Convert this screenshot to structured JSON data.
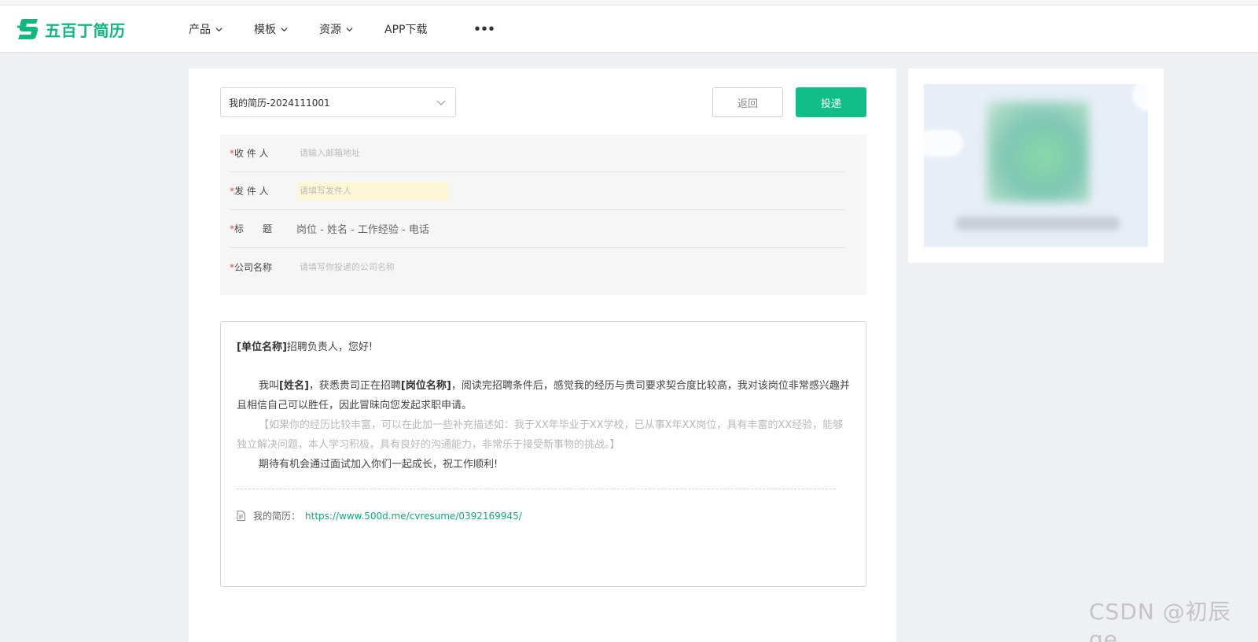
{
  "brand": {
    "name": "五百丁简历",
    "color": "#12b77d"
  },
  "nav": {
    "items": [
      {
        "label": "产品",
        "has_dropdown": true
      },
      {
        "label": "模板",
        "has_dropdown": true
      },
      {
        "label": "资源",
        "has_dropdown": true
      },
      {
        "label": "APP下载",
        "has_dropdown": false
      }
    ],
    "more": "•••"
  },
  "toolbar": {
    "resume_select_value": "我的简历-2024111001",
    "back_label": "返回",
    "send_label": "投递",
    "accent": "#0fbf87"
  },
  "form": {
    "required_mark": "*",
    "recipient_label": "收 件 人",
    "recipient_placeholder": "请输入邮箱地址",
    "sender_label": "发 件 人",
    "sender_placeholder": "请填写发件人",
    "subject_label": "标　　题",
    "subject_value": "岗位 - 姓名 - 工作经验 - 电话",
    "company_label": "公司名称",
    "company_placeholder": "请填写你投递的公司名称"
  },
  "letter": {
    "greeting_bold": "[单位名称]",
    "greeting_rest": "招聘负责人，您好!",
    "p1_a": "我叫",
    "p1_b": "[姓名]",
    "p1_c": "，获悉贵司正在招聘",
    "p1_d": "[岗位名称]",
    "p1_e": "，阅读完招聘条件后，感觉我的经历与贵司要求契合度比较高，我对该岗位非常感兴趣并且相信自己可以胜任，因此冒昧向您发起求职申请。",
    "p2": "【如果你的经历比较丰富，可以在此加一些补充描述如：我于XX年毕业于XX学校，已从事X年XX岗位，具有丰富的XX经验，能够独立解决问题，本人学习积极，具有良好的沟通能力，非常乐于接受新事物的挑战。】",
    "p3": "期待有机会通过面试加入你们一起成长，祝工作顺利!",
    "resume_link_label": "我的简历：",
    "resume_link_url": "https://www.500d.me/cvresume/0392169945/"
  },
  "watermark": "CSDN @初辰ge"
}
